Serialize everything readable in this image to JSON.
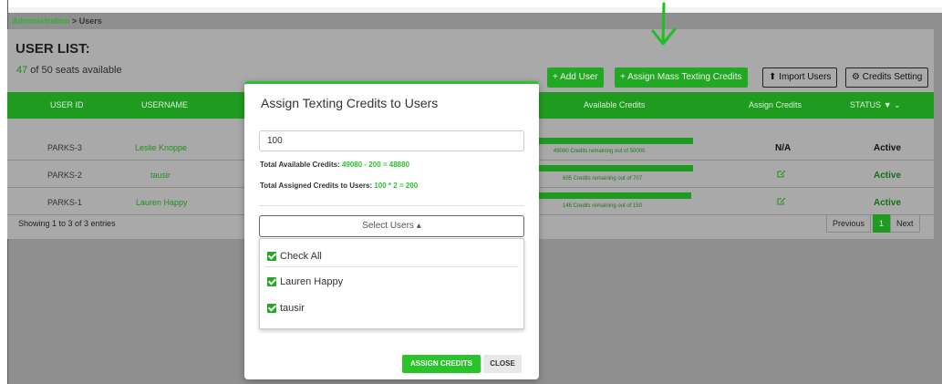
{
  "breadcrumb": {
    "parent": "Administration",
    "separator": " > ",
    "current": "Users"
  },
  "page": {
    "title": "USER LIST:",
    "seats_used": "47",
    "seats_text": " of 50 seats available"
  },
  "toolbar": {
    "add_user": "+ Add User",
    "assign_mass": "+ Assign Mass Texting Credits",
    "import_users": "Import Users",
    "credits_setting": "Credits Setting"
  },
  "table": {
    "headers": {
      "user_id": "USER ID",
      "username": "USERNAME",
      "available_credits": "Available Credits",
      "assign_credits": "Assign Credits",
      "status": "STATUS"
    },
    "rows": [
      {
        "user_id": "PARKS-3",
        "username": "Leslie Knoppe",
        "credits_text": "49080 Credits remaining out of 50000",
        "credits_fill": 0.98,
        "assign": "N/A",
        "status": "Active"
      },
      {
        "user_id": "PARKS-2",
        "username": "tausir",
        "credits_text": "695 Credits remaining out of 707",
        "credits_fill": 0.98,
        "assign": "",
        "status": "Active"
      },
      {
        "user_id": "PARKS-1",
        "username": "Lauren Happy",
        "credits_text": "146 Credits remaining out of 150",
        "credits_fill": 0.97,
        "assign": "",
        "status": "Active"
      }
    ],
    "showing": "Showing 1 to 3 of 3 entries",
    "pagination": {
      "previous": "Previous",
      "current": "1",
      "next": "Next"
    }
  },
  "modal": {
    "title": "Assign Texting Credits to Users",
    "input_value": "100",
    "available_label": "Total Available Credits: ",
    "available_calc": "49080 - 200 = 48880",
    "assigned_label": "Total Assigned Credits to Users: ",
    "assigned_calc": "100 * 2 = 200",
    "select_users": "Select Users ▴",
    "check_all": "Check All",
    "users": [
      "Lauren Happy",
      "tausir"
    ],
    "assign_button": "ASSIGN CREDITS",
    "close_button": "CLOSE"
  },
  "colors": {
    "accent_green": "#29c429",
    "header_green": "#1f9c1f"
  }
}
